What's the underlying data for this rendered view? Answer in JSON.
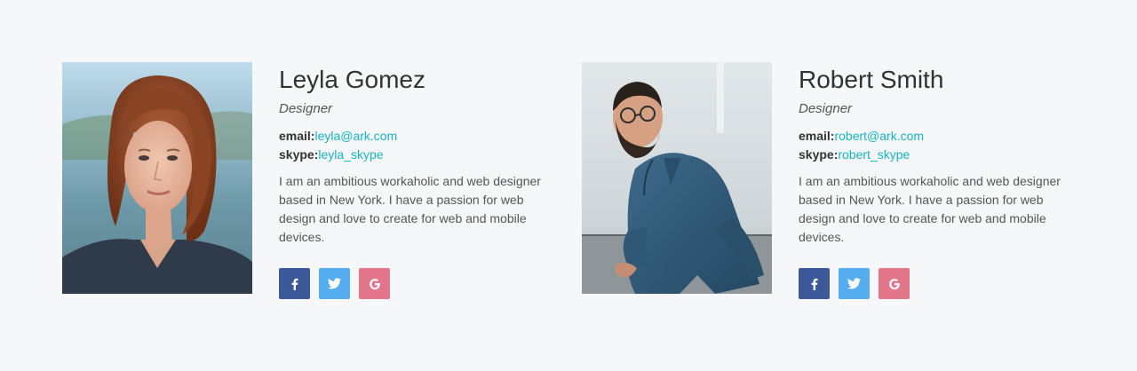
{
  "members": [
    {
      "name": "Leyla Gomez",
      "role": "Designer",
      "email_label": "email:",
      "email": "leyla@ark.com",
      "skype_label": "skype:",
      "skype": "leyla_skype",
      "bio": "I am an ambitious workaholic and web designer based in New York. I have a passion for web design and love to create for web and mobile devices.",
      "social": [
        {
          "icon": "facebook-icon",
          "color": "#3b5998"
        },
        {
          "icon": "twitter-icon",
          "color": "#55acee"
        },
        {
          "icon": "google-plus-icon",
          "color": "#e4768b"
        }
      ]
    },
    {
      "name": "Robert Smith",
      "role": "Designer",
      "email_label": "email:",
      "email": "robert@ark.com",
      "skype_label": "skype:",
      "skype": "robert_skype",
      "bio": "I am an ambitious workaholic and web designer based in New York. I have a passion for web design and love to create for web and mobile devices.",
      "social": [
        {
          "icon": "facebook-icon",
          "color": "#3b5998"
        },
        {
          "icon": "twitter-icon",
          "color": "#55acee"
        },
        {
          "icon": "google-plus-icon",
          "color": "#e4768b"
        }
      ]
    }
  ],
  "colors": {
    "background": "#f6f7f9",
    "link": "#17b3c1",
    "facebook": "#3b5998",
    "twitter": "#55acee",
    "google": "#e4768b"
  }
}
